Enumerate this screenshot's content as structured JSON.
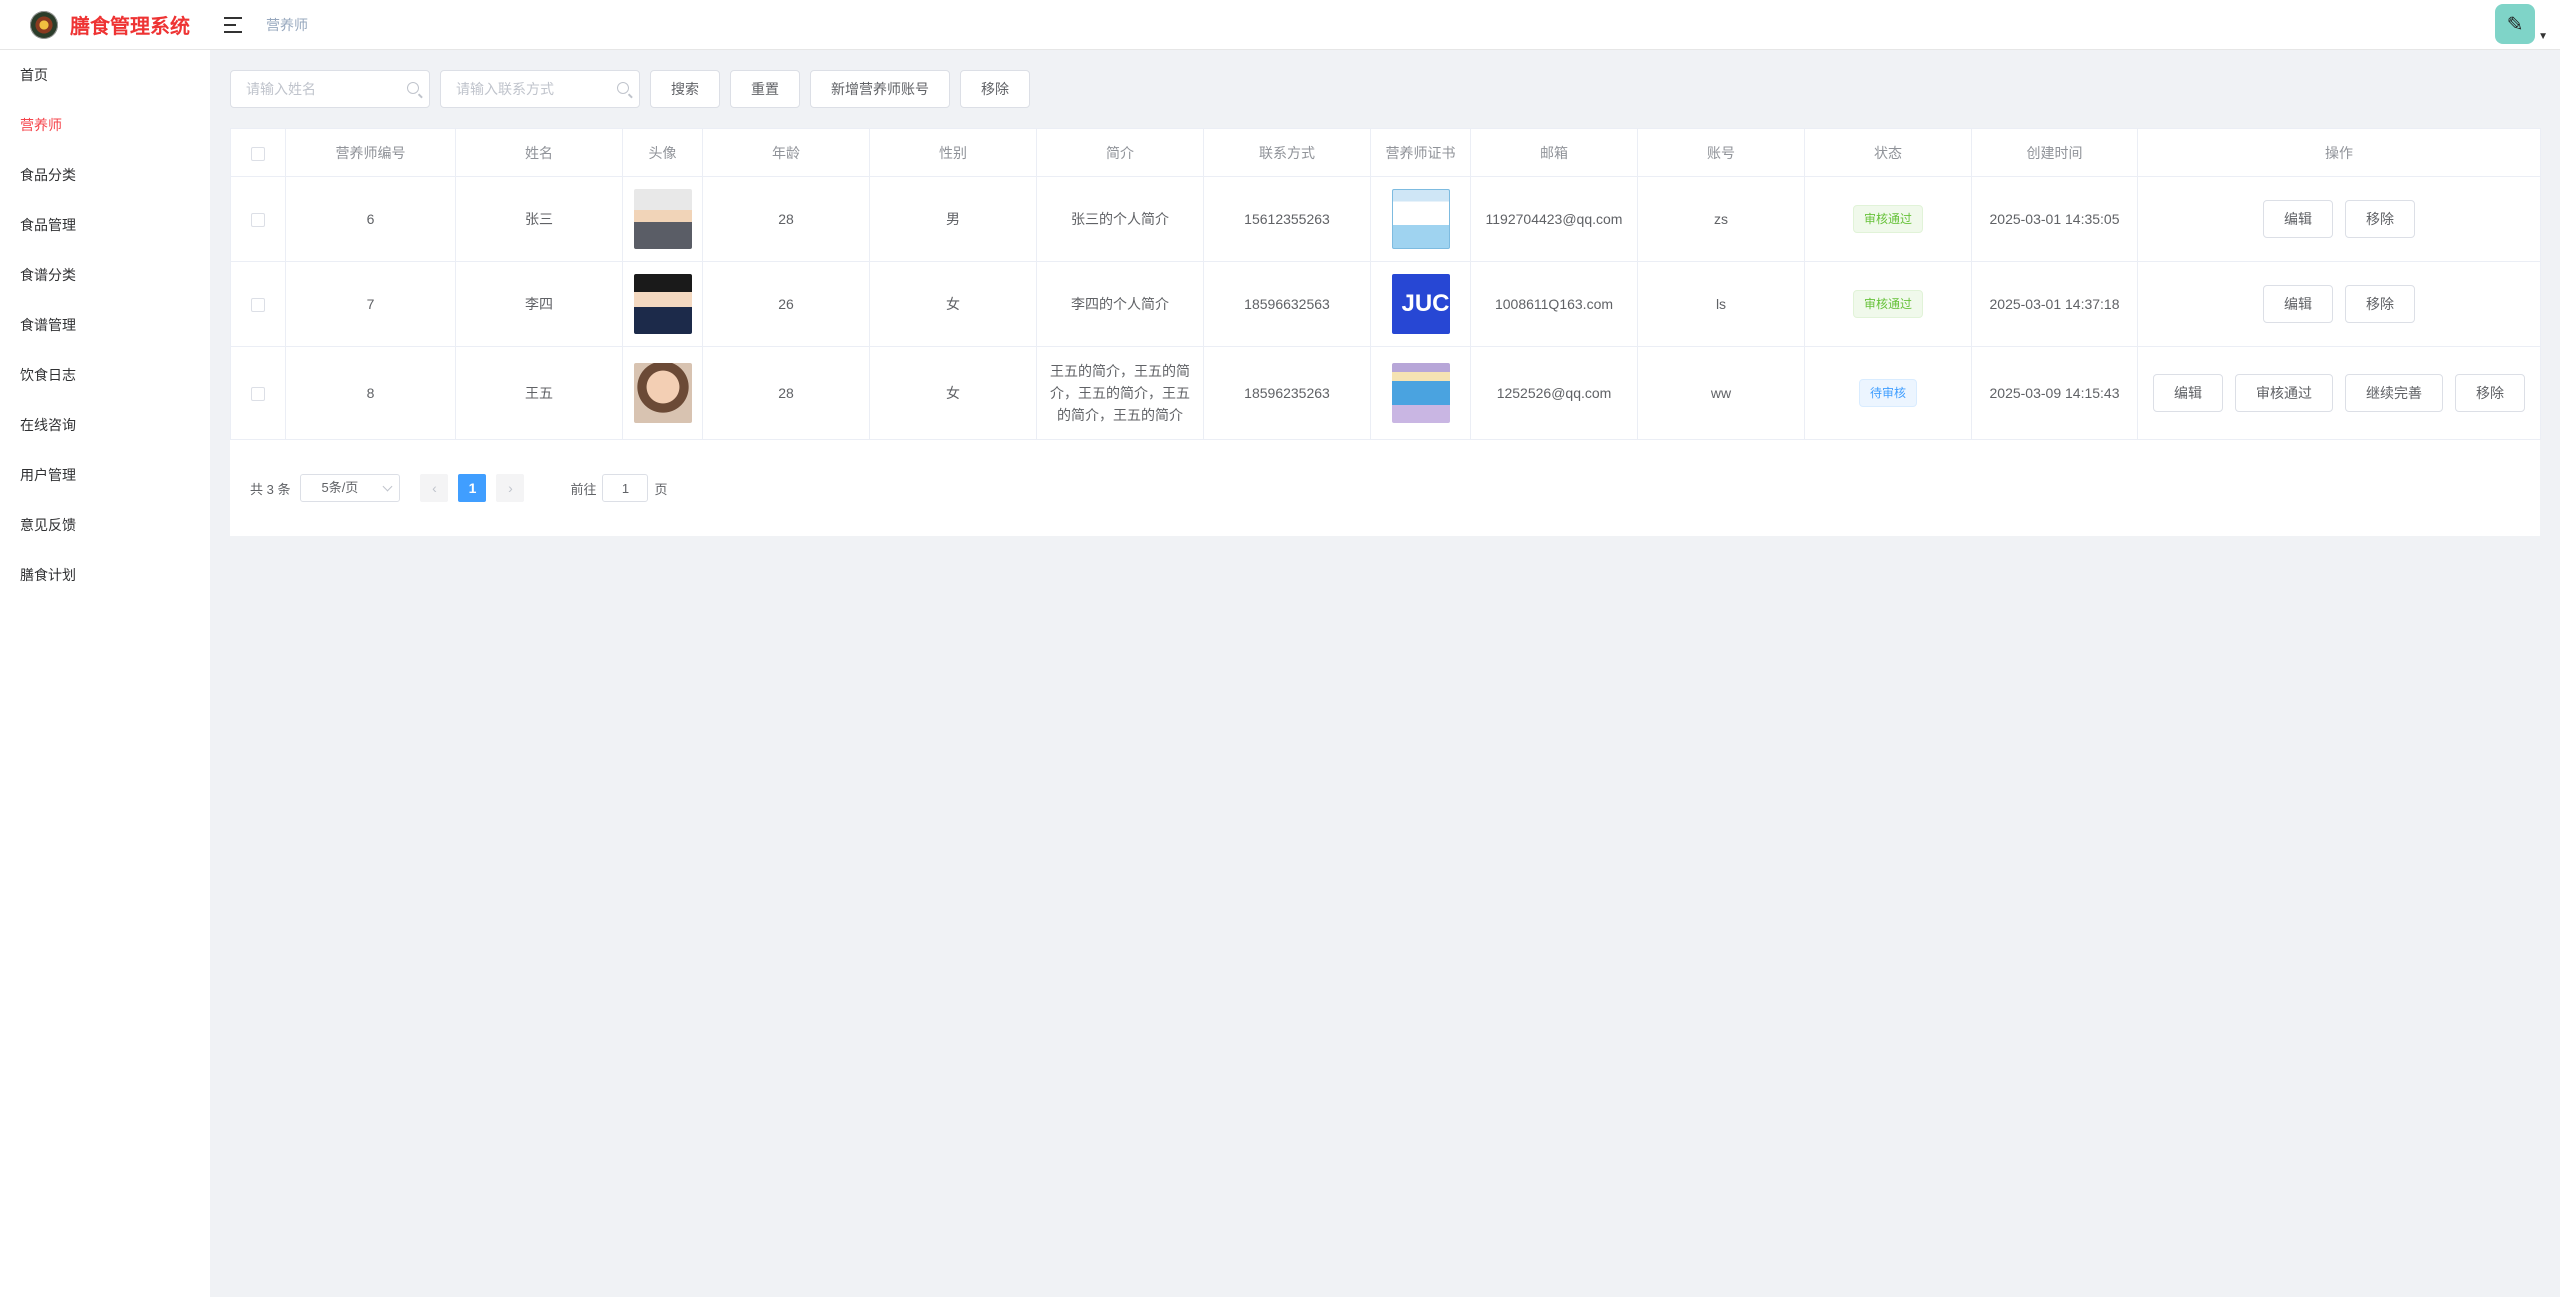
{
  "header": {
    "app_title": "膳食管理系统",
    "breadcrumb": "营养师"
  },
  "sidebar": {
    "items": [
      {
        "label": "首页"
      },
      {
        "label": "营养师",
        "active": true
      },
      {
        "label": "食品分类"
      },
      {
        "label": "食品管理"
      },
      {
        "label": "食谱分类"
      },
      {
        "label": "食谱管理"
      },
      {
        "label": "饮食日志"
      },
      {
        "label": "在线咨询"
      },
      {
        "label": "用户管理"
      },
      {
        "label": "意见反馈"
      },
      {
        "label": "膳食计划"
      }
    ]
  },
  "toolbar": {
    "name_placeholder": "请输入姓名",
    "contact_placeholder": "请输入联系方式",
    "search_label": "搜索",
    "reset_label": "重置",
    "add_label": "新增营养师账号",
    "remove_label": "移除"
  },
  "table": {
    "columns": [
      "营养师编号",
      "姓名",
      "头像",
      "年龄",
      "性别",
      "简介",
      "联系方式",
      "营养师证书",
      "邮箱",
      "账号",
      "状态",
      "创建时间",
      "操作"
    ],
    "rows": [
      {
        "id": "6",
        "name": "张三",
        "age": "28",
        "gender": "男",
        "intro": "张三的个人简介",
        "phone": "15612355263",
        "email": "1192704423@qq.com",
        "account": "zs",
        "status": "审核通过",
        "created": "2025-03-01 14:35:05",
        "cert_text": "",
        "actions": [
          "编辑",
          "移除"
        ]
      },
      {
        "id": "7",
        "name": "李四",
        "age": "26",
        "gender": "女",
        "intro": "李四的个人简介",
        "phone": "18596632563",
        "email": "1008611Q163.com",
        "account": "ls",
        "status": "审核通过",
        "created": "2025-03-01 14:37:18",
        "cert_text": "JUC",
        "actions": [
          "编辑",
          "移除"
        ]
      },
      {
        "id": "8",
        "name": "王五",
        "age": "28",
        "gender": "女",
        "intro": "王五的简介，王五的简介，王五的简介，王五的简介，王五的简介",
        "phone": "18596235263",
        "email": "1252526@qq.com",
        "account": "ww",
        "status": "待审核",
        "created": "2025-03-09 14:15:43",
        "cert_text": "",
        "actions": [
          "编辑",
          "审核通过",
          "继续完善",
          "移除"
        ]
      }
    ]
  },
  "pagination": {
    "total_text": "共 3 条",
    "page_size": "5条/页",
    "prev_icon": "chevron-left",
    "next_icon": "chevron-right",
    "current_page": "1",
    "goto_prefix": "前往",
    "goto_value": "1",
    "goto_suffix": "页"
  }
}
